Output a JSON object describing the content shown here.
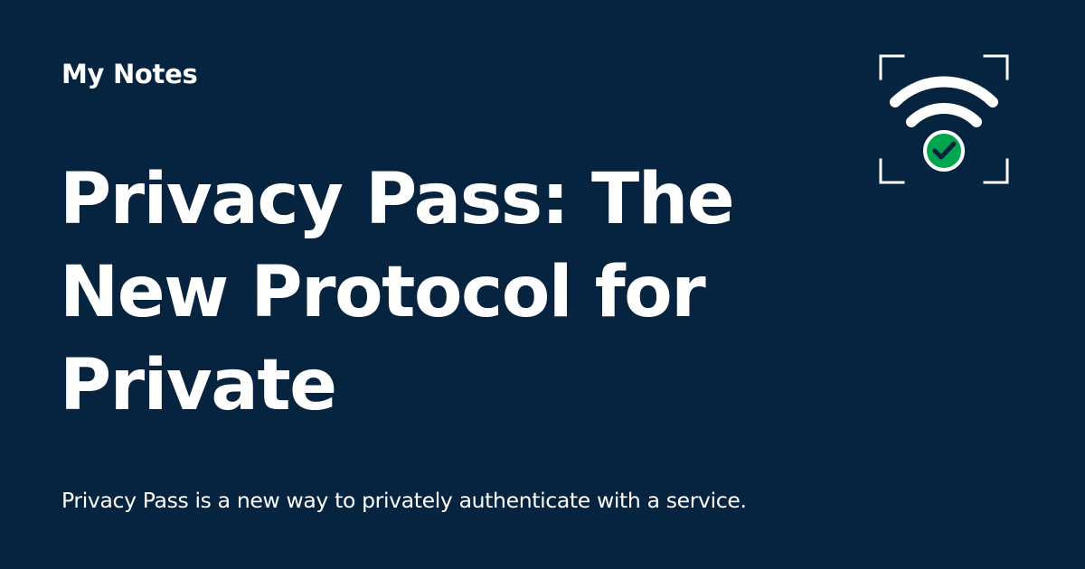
{
  "header": {
    "site_name": "My Notes"
  },
  "article": {
    "title_lines": [
      "Privacy Pass: The",
      "New Protocol for",
      "Private"
    ],
    "description": "Privacy Pass is a new way to privately authenticate with a service."
  },
  "logo": {
    "icons": [
      "frame-corners-icon",
      "wifi-icon",
      "checkmark-badge-icon"
    ],
    "colors": {
      "foreground": "#ffffff",
      "badge": "#00a550",
      "background": "#06233f"
    }
  }
}
